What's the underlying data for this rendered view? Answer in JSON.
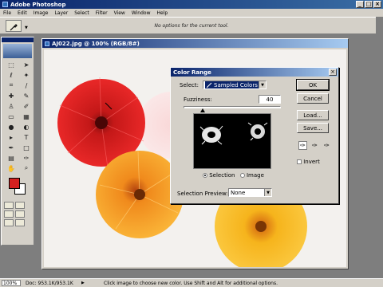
{
  "app": {
    "title": "Adobe Photoshop",
    "window_buttons": [
      "_",
      "□",
      "×"
    ]
  },
  "menu": [
    "File",
    "Edit",
    "Image",
    "Layer",
    "Select",
    "Filter",
    "View",
    "Window",
    "Help"
  ],
  "options_bar": {
    "message": "No options for the current tool."
  },
  "document": {
    "title": "AJ022.jpg @ 100% (RGB/8#)"
  },
  "colors": {
    "foreground": "#d32020",
    "background": "#ffffff",
    "title_bar": "#0a246a"
  },
  "color_range": {
    "title": "Color Range",
    "select_label": "Select:",
    "select_value": "Sampled Colors",
    "fuzziness_label": "Fuzziness:",
    "fuzziness_value": "40",
    "fuzziness_level": 0.2,
    "view_selection": "Selection",
    "view_image": "Image",
    "view_selected": "selection",
    "preview_label": "Selection Preview:",
    "preview_value": "None",
    "buttons": {
      "ok": "OK",
      "cancel": "Cancel",
      "load": "Load...",
      "save": "Save..."
    },
    "invert_label": "Invert",
    "invert_checked": false,
    "eyedroppers": [
      "eyedropper-icon",
      "eyedropper-plus-icon",
      "eyedropper-minus-icon"
    ]
  },
  "status": {
    "zoom": "100%",
    "doc_info": "Doc: 953.1K/953.1K",
    "hint": "Click image to choose new color.  Use Shift and Alt for additional options."
  }
}
